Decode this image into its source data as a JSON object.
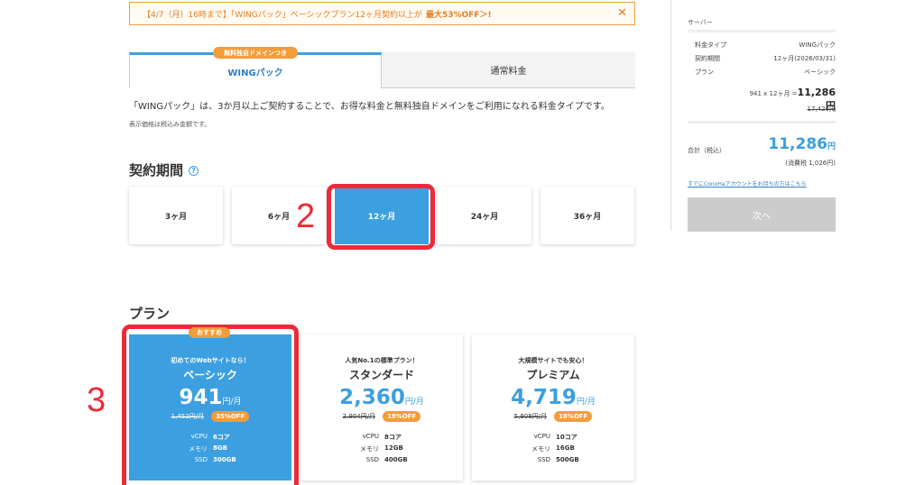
{
  "banner": {
    "text": "【4/7（月）16時まで】「WINGパック」ベーシックプラン12ヶ月契約以上が",
    "highlight": "最大53%OFF＞!",
    "close": "✕"
  },
  "tabs": {
    "badge": "無料独自ドメインつき",
    "active": "WINGパック",
    "normal": "通常料金"
  },
  "description": "「WINGパック」は、3か月以上ご契約することで、お得な料金と無料独自ドメインをご利用になれる料金タイプです。",
  "tax_note": "表示価格は税込み金額です。",
  "period": {
    "heading": "契約期間",
    "help": "?",
    "options": [
      "3ヶ月",
      "6ヶ月",
      "12ヶ月",
      "24ヶ月",
      "36ヶ月"
    ],
    "selected": "12ヶ月"
  },
  "annotations": {
    "step2": "2",
    "step3": "3"
  },
  "plans": {
    "heading": "プラン",
    "recommend": "おすすめ",
    "items": [
      {
        "tag": "初めてのWebサイトなら！",
        "name": "ベーシック",
        "price": "941",
        "unit": "円/月",
        "original": "1,452円/月",
        "off": "35%OFF",
        "vcpu_label": "vCPU",
        "vcpu": "6コア",
        "mem_label": "メモリ",
        "mem": "8GB",
        "ssd_label": "SSD",
        "ssd": "300GB"
      },
      {
        "tag": "人気No.1の標準プラン！",
        "name": "スタンダード",
        "price": "2,360",
        "unit": "円/月",
        "original": "2,904円/月",
        "off": "18%OFF",
        "vcpu_label": "vCPU",
        "vcpu": "8コア",
        "mem_label": "メモリ",
        "mem": "12GB",
        "ssd_label": "SSD",
        "ssd": "400GB"
      },
      {
        "tag": "大規模サイトでも安心！",
        "name": "プレミアム",
        "price": "4,719",
        "unit": "円/月",
        "original": "5,808円/月",
        "off": "18%OFF",
        "vcpu_label": "vCPU",
        "vcpu": "10コア",
        "mem_label": "メモリ",
        "mem": "16GB",
        "ssd_label": "SSD",
        "ssd": "500GB"
      }
    ]
  },
  "summary": {
    "section": "サーバー",
    "rate_label": "料金タイプ",
    "rate": "WINGパック",
    "term_label": "契約期間",
    "term": "12ヶ月(2026/03/31)",
    "plan_label": "プラン",
    "plan": "ベーシック",
    "calc": "941 x 12ヶ月 =",
    "calc_total": "11,286円",
    "calc_original": "17,424円",
    "total_label": "合計（税込）",
    "total": "11,286",
    "total_unit": "円",
    "tax": "(消費税 1,026円)",
    "login_link": "すでにConoHaアカウントをお持ちの方はこちら",
    "next": "次へ"
  },
  "colors": {
    "accent": "#3c9fe0",
    "orange": "#f39c3a",
    "annotation": "#ec2a3a"
  }
}
